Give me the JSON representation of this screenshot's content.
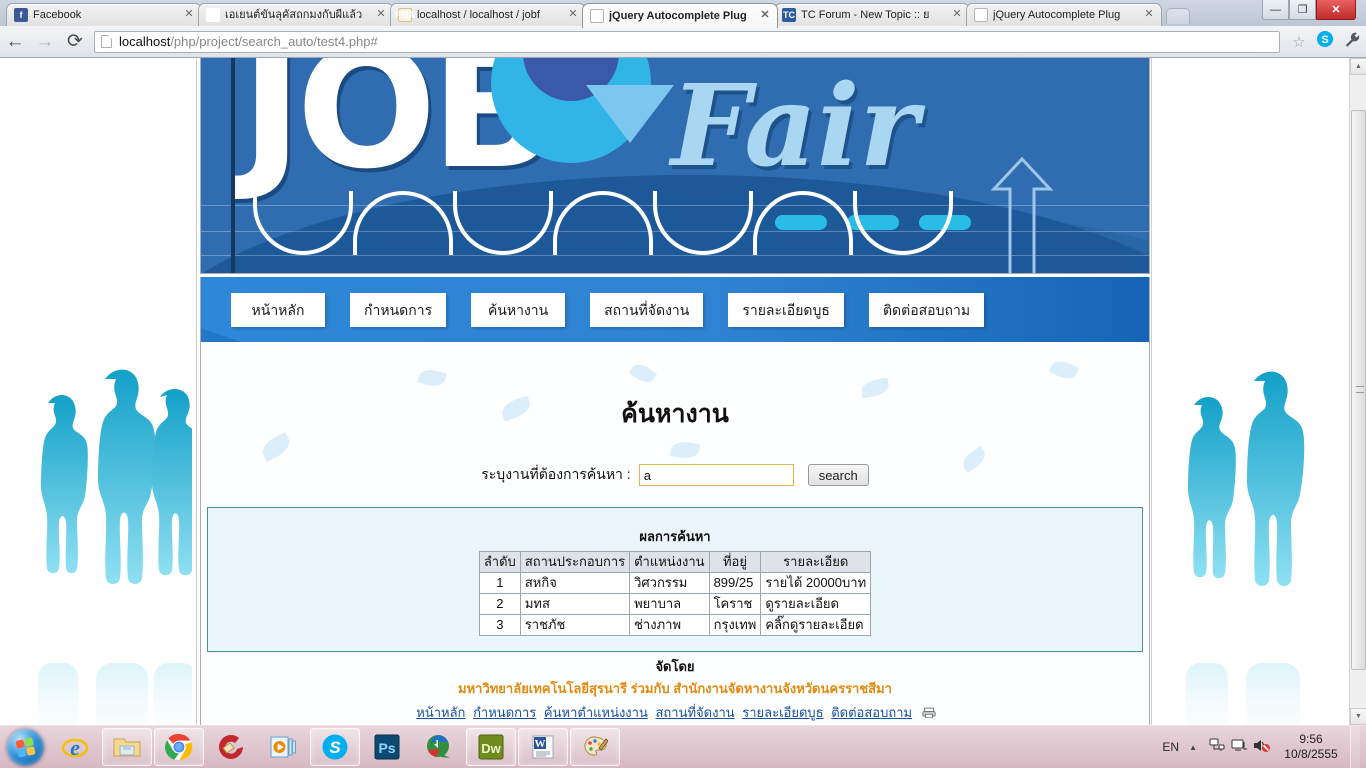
{
  "browser": {
    "tabs": [
      {
        "title": "Facebook",
        "favicon": "facebook-icon",
        "active": false
      },
      {
        "title": "เอเยนต์ขันลุคัสถกมงกับผีแล้ว",
        "favicon": "red-dot-icon",
        "active": false
      },
      {
        "title": "localhost / localhost / jobf",
        "favicon": "phpmyadmin-icon",
        "active": false
      },
      {
        "title": "jQuery Autocomplete Plug",
        "favicon": "page-icon",
        "active": true
      },
      {
        "title": "TC Forum - New Topic :: ย",
        "favicon": "forum-icon",
        "active": false
      },
      {
        "title": "jQuery Autocomplete Plug",
        "favicon": "page-icon",
        "active": false
      }
    ],
    "close_tab_glyph": "✕",
    "new_tab_label": "",
    "window_controls": {
      "minimize": "—",
      "maximize": "❐",
      "close": "✕"
    },
    "nav": {
      "back": "←",
      "forward": "→",
      "reload": "⟳"
    },
    "address": {
      "host": "localhost",
      "path": "/php/project/search_auto/test4.php#",
      "full": "localhost/php/project/search_auto/test4.php#"
    },
    "toolbar_icons": [
      {
        "name": "bookmark-star-icon",
        "glyph": "☆"
      },
      {
        "name": "skype-extension-icon",
        "glyph": "S"
      },
      {
        "name": "chrome-menu-wrench-icon",
        "glyph": "🔧"
      }
    ]
  },
  "banner": {
    "word_job": "JOB",
    "word_fair": "Fair"
  },
  "nav_menu": {
    "items": [
      {
        "label": "หน้าหลัก"
      },
      {
        "label": "กำหนดการ"
      },
      {
        "label": "ค้นหางาน"
      },
      {
        "label": "สถานที่จัดงาน"
      },
      {
        "label": "รายละเอียดบูธ"
      },
      {
        "label": "ติดต่อสอบถาม"
      }
    ]
  },
  "main": {
    "page_title": "ค้นหางาน",
    "search": {
      "label": "ระบุงานที่ต้องการค้นหา :",
      "value": "a",
      "placeholder": "",
      "button_label": "search"
    },
    "results": {
      "caption": "ผลการค้นหา",
      "columns": [
        "ลำดับ",
        "สถานประกอบการ",
        "ตำแหน่งงาน",
        "ที่อยู่",
        "รายละเอียด"
      ],
      "rows": [
        [
          "1",
          "สหกิจ",
          "วิศวกรรม",
          "899/25",
          "รายได้ 20000บาท"
        ],
        [
          "2",
          "มทส",
          "พยาบาล",
          "โคราช",
          "ดูรายละเอียด"
        ],
        [
          "3",
          "ราชภัช",
          "ช่างภาพ",
          "กรุงเทพ",
          "คลิ๊กดูรายละเอียด"
        ]
      ]
    }
  },
  "footer": {
    "organized_by": "จัดโดย",
    "organization": "มหาวิทยาลัยเทคโนโลยีสุรนารี ร่วมกับ สำนักงานจัดหางานจังหวัดนครราชสีมา",
    "links": [
      "หน้าหลัก",
      "กำหนดการ",
      "ค้นหาตำแหน่งงาน",
      "สถานที่จัดงาน",
      "รายละเอียดบูธ",
      "ติดต่อสอบถาม"
    ]
  },
  "taskbar": {
    "start_label": "",
    "buttons": [
      {
        "name": "internet-explorer-icon"
      },
      {
        "name": "windows-explorer-icon"
      },
      {
        "name": "google-chrome-icon"
      },
      {
        "name": "ccleaner-icon"
      },
      {
        "name": "media-player-icon"
      },
      {
        "name": "skype-icon"
      },
      {
        "name": "photoshop-icon",
        "label": "Ps"
      },
      {
        "name": "internet-download-manager-icon"
      },
      {
        "name": "dreamweaver-icon",
        "label": "Dw"
      },
      {
        "name": "microsoft-word-icon",
        "label": "W"
      },
      {
        "name": "paint-icon"
      }
    ],
    "tray": {
      "language": "EN",
      "show_hidden_glyph": "▲",
      "icons": [
        {
          "name": "network-icon",
          "glyph": "🖧"
        },
        {
          "name": "action-center-icon",
          "glyph": "🗔"
        },
        {
          "name": "volume-muted-icon",
          "glyph": "🔇"
        }
      ],
      "time": "9:56",
      "date": "10/8/2555"
    }
  },
  "colors": {
    "banner_blue": "#2f6cb0",
    "nav_blue": "#2e87d8",
    "accent_orange": "#e38b12",
    "link_blue": "#1a4fa0",
    "result_panel_bg": "#eaf6fb",
    "result_panel_border": "#4b8fa3",
    "input_border": "#e0b64e"
  }
}
